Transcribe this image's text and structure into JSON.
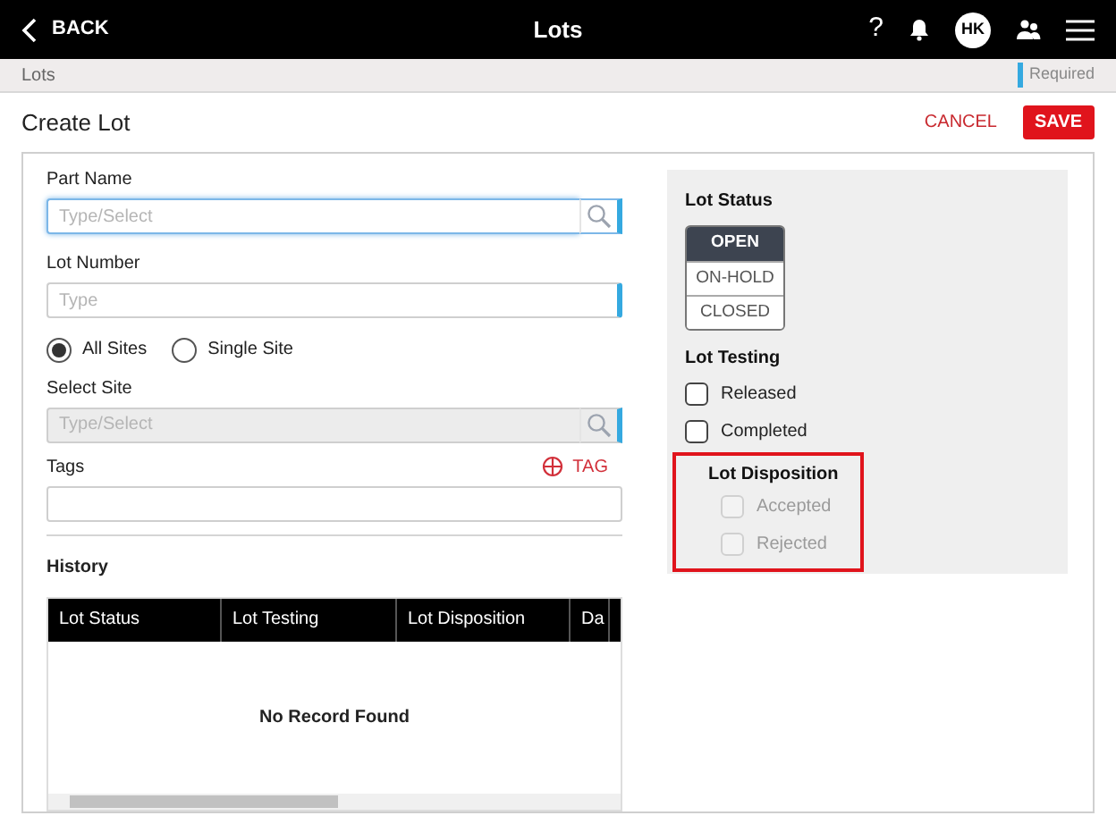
{
  "header": {
    "back": "BACK",
    "title": "Lots",
    "help": "?",
    "avatar": "HK"
  },
  "breadcrumb": {
    "path": "Lots",
    "required": "Required"
  },
  "page": {
    "title": "Create Lot",
    "cancel": "CANCEL",
    "save": "SAVE"
  },
  "fields": [
    {
      "label": "Part Name",
      "placeholder": "Type/Select",
      "search": true,
      "disabled": false,
      "focused": true
    },
    {
      "label": "Lot Number",
      "placeholder": "Type",
      "search": false,
      "disabled": false,
      "focused": false
    }
  ],
  "site_options": [
    {
      "label": "All Sites",
      "selected": true
    },
    {
      "label": "Single Site",
      "selected": false
    }
  ],
  "select_site": {
    "label": "Select Site",
    "placeholder": "Type/Select",
    "disabled": true
  },
  "tags": {
    "label": "Tags",
    "add": "TAG"
  },
  "history": {
    "title": "History",
    "columns": [
      "Lot Status",
      "Lot Testing",
      "Lot Disposition",
      "Da"
    ],
    "empty": "No Record Found"
  },
  "lot_status": {
    "title": "Lot Status",
    "options": [
      {
        "label": "OPEN",
        "selected": true
      },
      {
        "label": "ON-HOLD",
        "selected": false
      },
      {
        "label": "CLOSED",
        "selected": false
      }
    ]
  },
  "lot_testing": {
    "title": "Lot Testing",
    "items": [
      {
        "label": "Released",
        "checked": false
      },
      {
        "label": "Completed",
        "checked": false
      }
    ]
  },
  "lot_disposition": {
    "title": "Lot Disposition",
    "highlighted": true,
    "items": [
      {
        "label": "Accepted",
        "checked": false,
        "disabled": true
      },
      {
        "label": "Rejected",
        "checked": false,
        "disabled": true
      }
    ]
  }
}
